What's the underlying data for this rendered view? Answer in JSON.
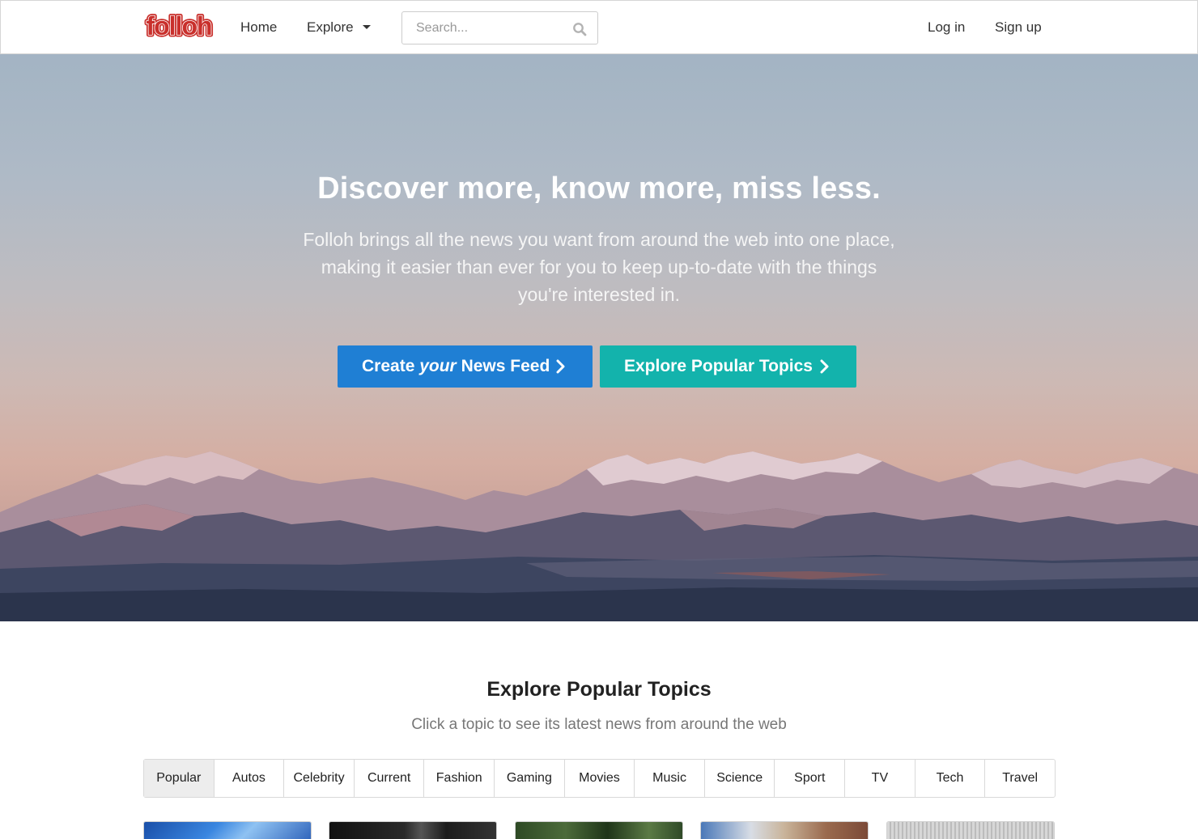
{
  "nav": {
    "logo_text": "folloh",
    "home": "Home",
    "explore": "Explore",
    "search_placeholder": "Search...",
    "login": "Log in",
    "signup": "Sign up"
  },
  "hero": {
    "title": "Discover more, know more, miss less.",
    "subtitle": "Folloh brings all the news you want from around the web into one place, making it easier than ever for you to keep up-to-date with the things you're interested in.",
    "create_prefix": "Create",
    "create_emphasis": "your",
    "create_suffix": "News Feed",
    "explore_button": "Explore Popular Topics"
  },
  "topics": {
    "title": "Explore Popular Topics",
    "subtitle": "Click a topic to see its latest news from around the web",
    "tabs": [
      "Popular",
      "Autos",
      "Celebrity",
      "Current",
      "Fashion",
      "Gaming",
      "Movies",
      "Music",
      "Science",
      "Sport",
      "TV",
      "Tech",
      "Travel"
    ],
    "active_tab": "Popular"
  },
  "colors": {
    "brand_red": "#c9302c",
    "create_blue": "#1f7fd4",
    "explore_teal": "#13b3ac"
  }
}
